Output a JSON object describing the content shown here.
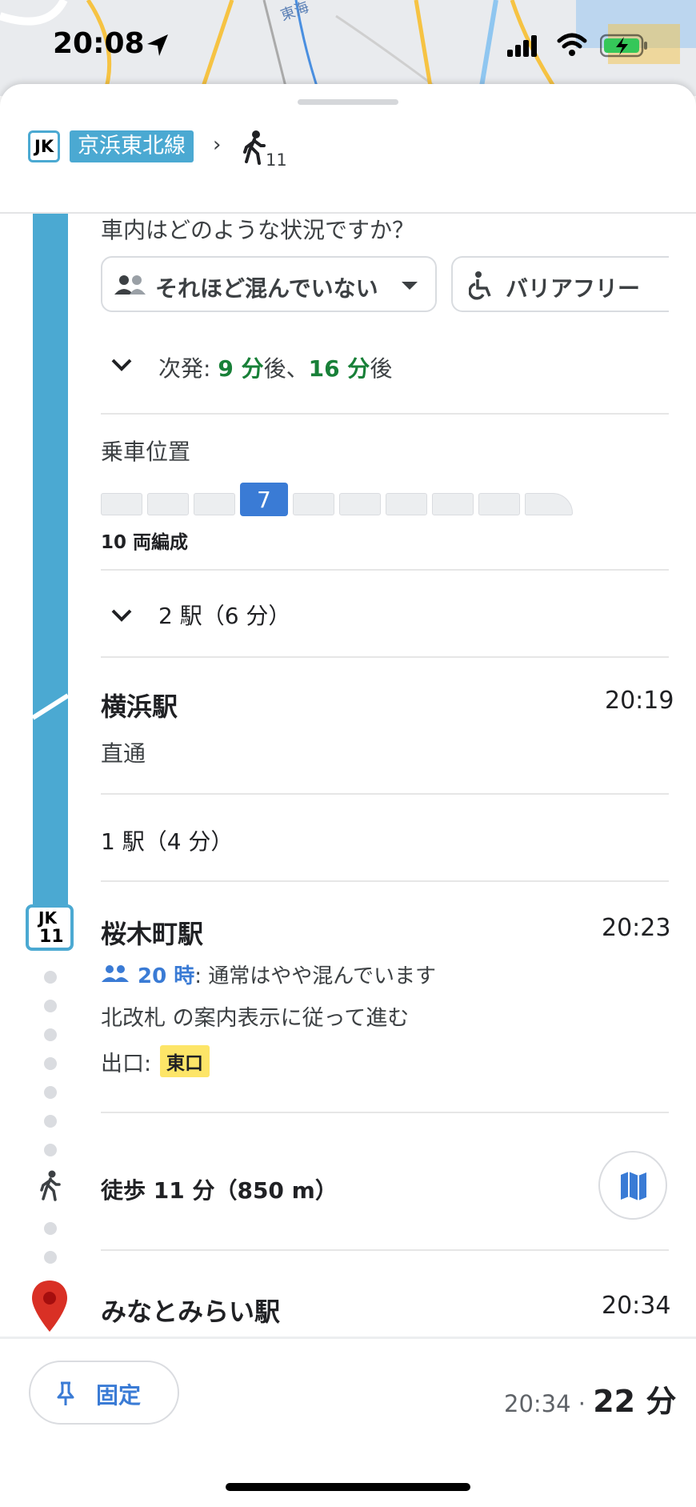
{
  "status": {
    "time": "20:08"
  },
  "map": {
    "label_top": "東海"
  },
  "route": {
    "line_badge": "JK",
    "line_name": "京浜東北線",
    "walk_count": "11",
    "colors": {
      "line": "#4ba9d2",
      "accent_green": "#188038",
      "accent_blue": "#3a7bd5",
      "pin": "#d93025"
    }
  },
  "crowd_question": "車内はどのような状況ですか？",
  "chips": [
    {
      "label": "それほど混んでいない",
      "icon": "people-icon"
    },
    {
      "label": "バリアフリー",
      "icon": "wheelchair-icon"
    }
  ],
  "next_departures": {
    "prefix": "次発: ",
    "first": "9 分",
    "sep": "後、",
    "second": "16 分",
    "suffix": "後"
  },
  "boarding": {
    "title": "乗車位置",
    "highlighted_car": "7",
    "car_count_label": "10 両編成",
    "car_count": 10
  },
  "stops_group1": "2 駅（6 分）",
  "station1": {
    "name": "横浜駅",
    "time": "20:19",
    "note": "直通"
  },
  "stops_group2": "1 駅（4 分）",
  "station2": {
    "badge_line": "JK",
    "badge_num": "11",
    "name": "桜木町駅",
    "time": "20:23",
    "crowd_hour": "20 時",
    "crowd_text": ": 通常はやや混んでいます",
    "direction": "北改札 の案内表示に従って進む",
    "exit_label": "出口: ",
    "exit_name": "東口"
  },
  "walk": {
    "label": "徒歩 11 分（850 m）"
  },
  "destination": {
    "name": "みなとみらい駅",
    "time": "20:34"
  },
  "footer": {
    "pin_label": "固定",
    "arrival": "20:34",
    "dot": " · ",
    "duration": "22 分"
  }
}
